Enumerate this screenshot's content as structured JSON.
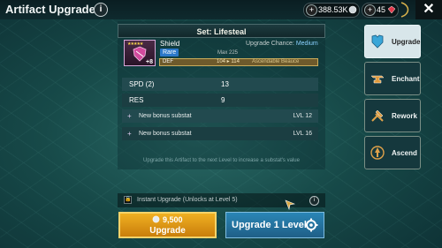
{
  "header": {
    "title": "Artifact Upgrade",
    "info_icon": "i"
  },
  "resources": {
    "silver": "388.53K",
    "gems": "45"
  },
  "close_label": "✕",
  "set": {
    "title": "Set: Lifesteal"
  },
  "item": {
    "name": "Shield",
    "rarity": "Rare",
    "level": "+8",
    "upgrade_chance_label": "Upgrade Chance:",
    "upgrade_chance_value": "Medium",
    "max_label": "Max 225",
    "main_stat": {
      "label": "DEF",
      "values": "104 ▸ 114",
      "requirement": "Ascendable Beauce"
    }
  },
  "substats": [
    {
      "name": "SPD (2)",
      "value": "13"
    },
    {
      "name": "RES",
      "value": "9"
    }
  ],
  "bonus_slots": [
    {
      "plus": "+",
      "label": "New bonus substat",
      "level": "LVL 12"
    },
    {
      "plus": "+",
      "label": "New bonus substat",
      "level": "LVL 16"
    }
  ],
  "hint": "Upgrade this Artifact to the next Level to increase a substat's value",
  "instant_upgrade": {
    "label": "Instant Upgrade (Unlocks at Level 5)",
    "checkbox_icon": "lock-icon",
    "info": "i"
  },
  "upgrade_button": {
    "cost": "9,500",
    "label": "Upgrade"
  },
  "upgrade_level_button": {
    "label": "Upgrade 1 Level"
  },
  "tabs": [
    {
      "label": "Upgrade",
      "icon": "armor-icon",
      "active": true
    },
    {
      "label": "Enchant",
      "icon": "anvil-icon",
      "active": false
    },
    {
      "label": "Rework",
      "icon": "hammer-icon",
      "active": false
    },
    {
      "label": "Ascend",
      "icon": "ascend-icon",
      "active": false
    }
  ],
  "colors": {
    "accent_gold": "#f0b022",
    "accent_blue": "#2a86b6",
    "rare_blue": "#2b78c9"
  }
}
